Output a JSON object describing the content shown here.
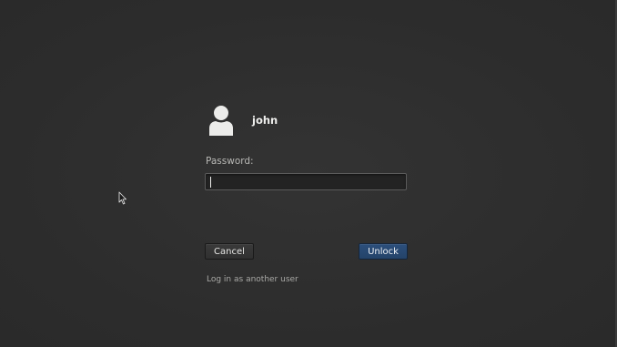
{
  "user": {
    "name": "john",
    "avatar_icon": "user-avatar-icon"
  },
  "password": {
    "label": "Password:",
    "value": ""
  },
  "buttons": {
    "cancel_label": "Cancel",
    "unlock_label": "Unlock"
  },
  "links": {
    "other_user": "Log in as another user"
  },
  "colors": {
    "background": "#2e2e2e",
    "accent": "#2c4f7c",
    "text": "#eeeeec"
  }
}
